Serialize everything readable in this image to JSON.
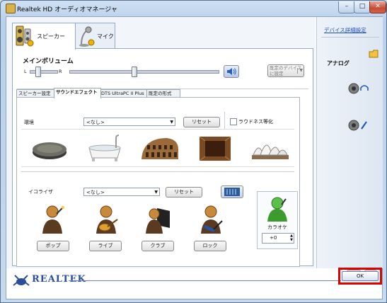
{
  "window": {
    "title": "Realtek HD オーディオマネージャ",
    "controls": [
      "–",
      "□",
      "✕"
    ]
  },
  "device_tabs": [
    {
      "label": "スピーカー",
      "active": true
    },
    {
      "label": "マイク",
      "active": false
    }
  ],
  "volume": {
    "title": "メインボリューム",
    "left_label": "L",
    "right_label": "R",
    "balance_value": 0.24,
    "level_value": 0.43,
    "default_device_label": "既定のデバイスに設定"
  },
  "sub_tabs": [
    {
      "label": "スピーカー設定",
      "active": false
    },
    {
      "label": "サウンドエフェクト",
      "active": true
    },
    {
      "label": "DTS UltraPC II Plus",
      "active": false
    },
    {
      "label": "既定の形式",
      "active": false
    }
  ],
  "environment": {
    "label": "環境",
    "select_value": "<なし>",
    "reset_label": "リセット",
    "loudness_label": "ラウドネス等化",
    "loudness_checked": false,
    "presets": [
      "stone-disc",
      "bathtub",
      "colosseum",
      "wooden-room",
      "opera-house"
    ]
  },
  "equalizer": {
    "label": "イコライザ",
    "select_value": "<なし>",
    "reset_label": "リセット",
    "presets": [
      "ポップ",
      "ライブ",
      "クラブ",
      "ロック"
    ],
    "karaoke_label": "カラオケ",
    "karaoke_value": "+0"
  },
  "right_panel": {
    "advanced_link": "デバイス詳細設定",
    "analog_label": "アナログ"
  },
  "footer": {
    "brand": "REALTEK",
    "ok_label": "OK"
  },
  "colors": {
    "ok_highlight": "#e00000",
    "link": "#1a4ec4",
    "rule_line": "#6a88b5"
  }
}
